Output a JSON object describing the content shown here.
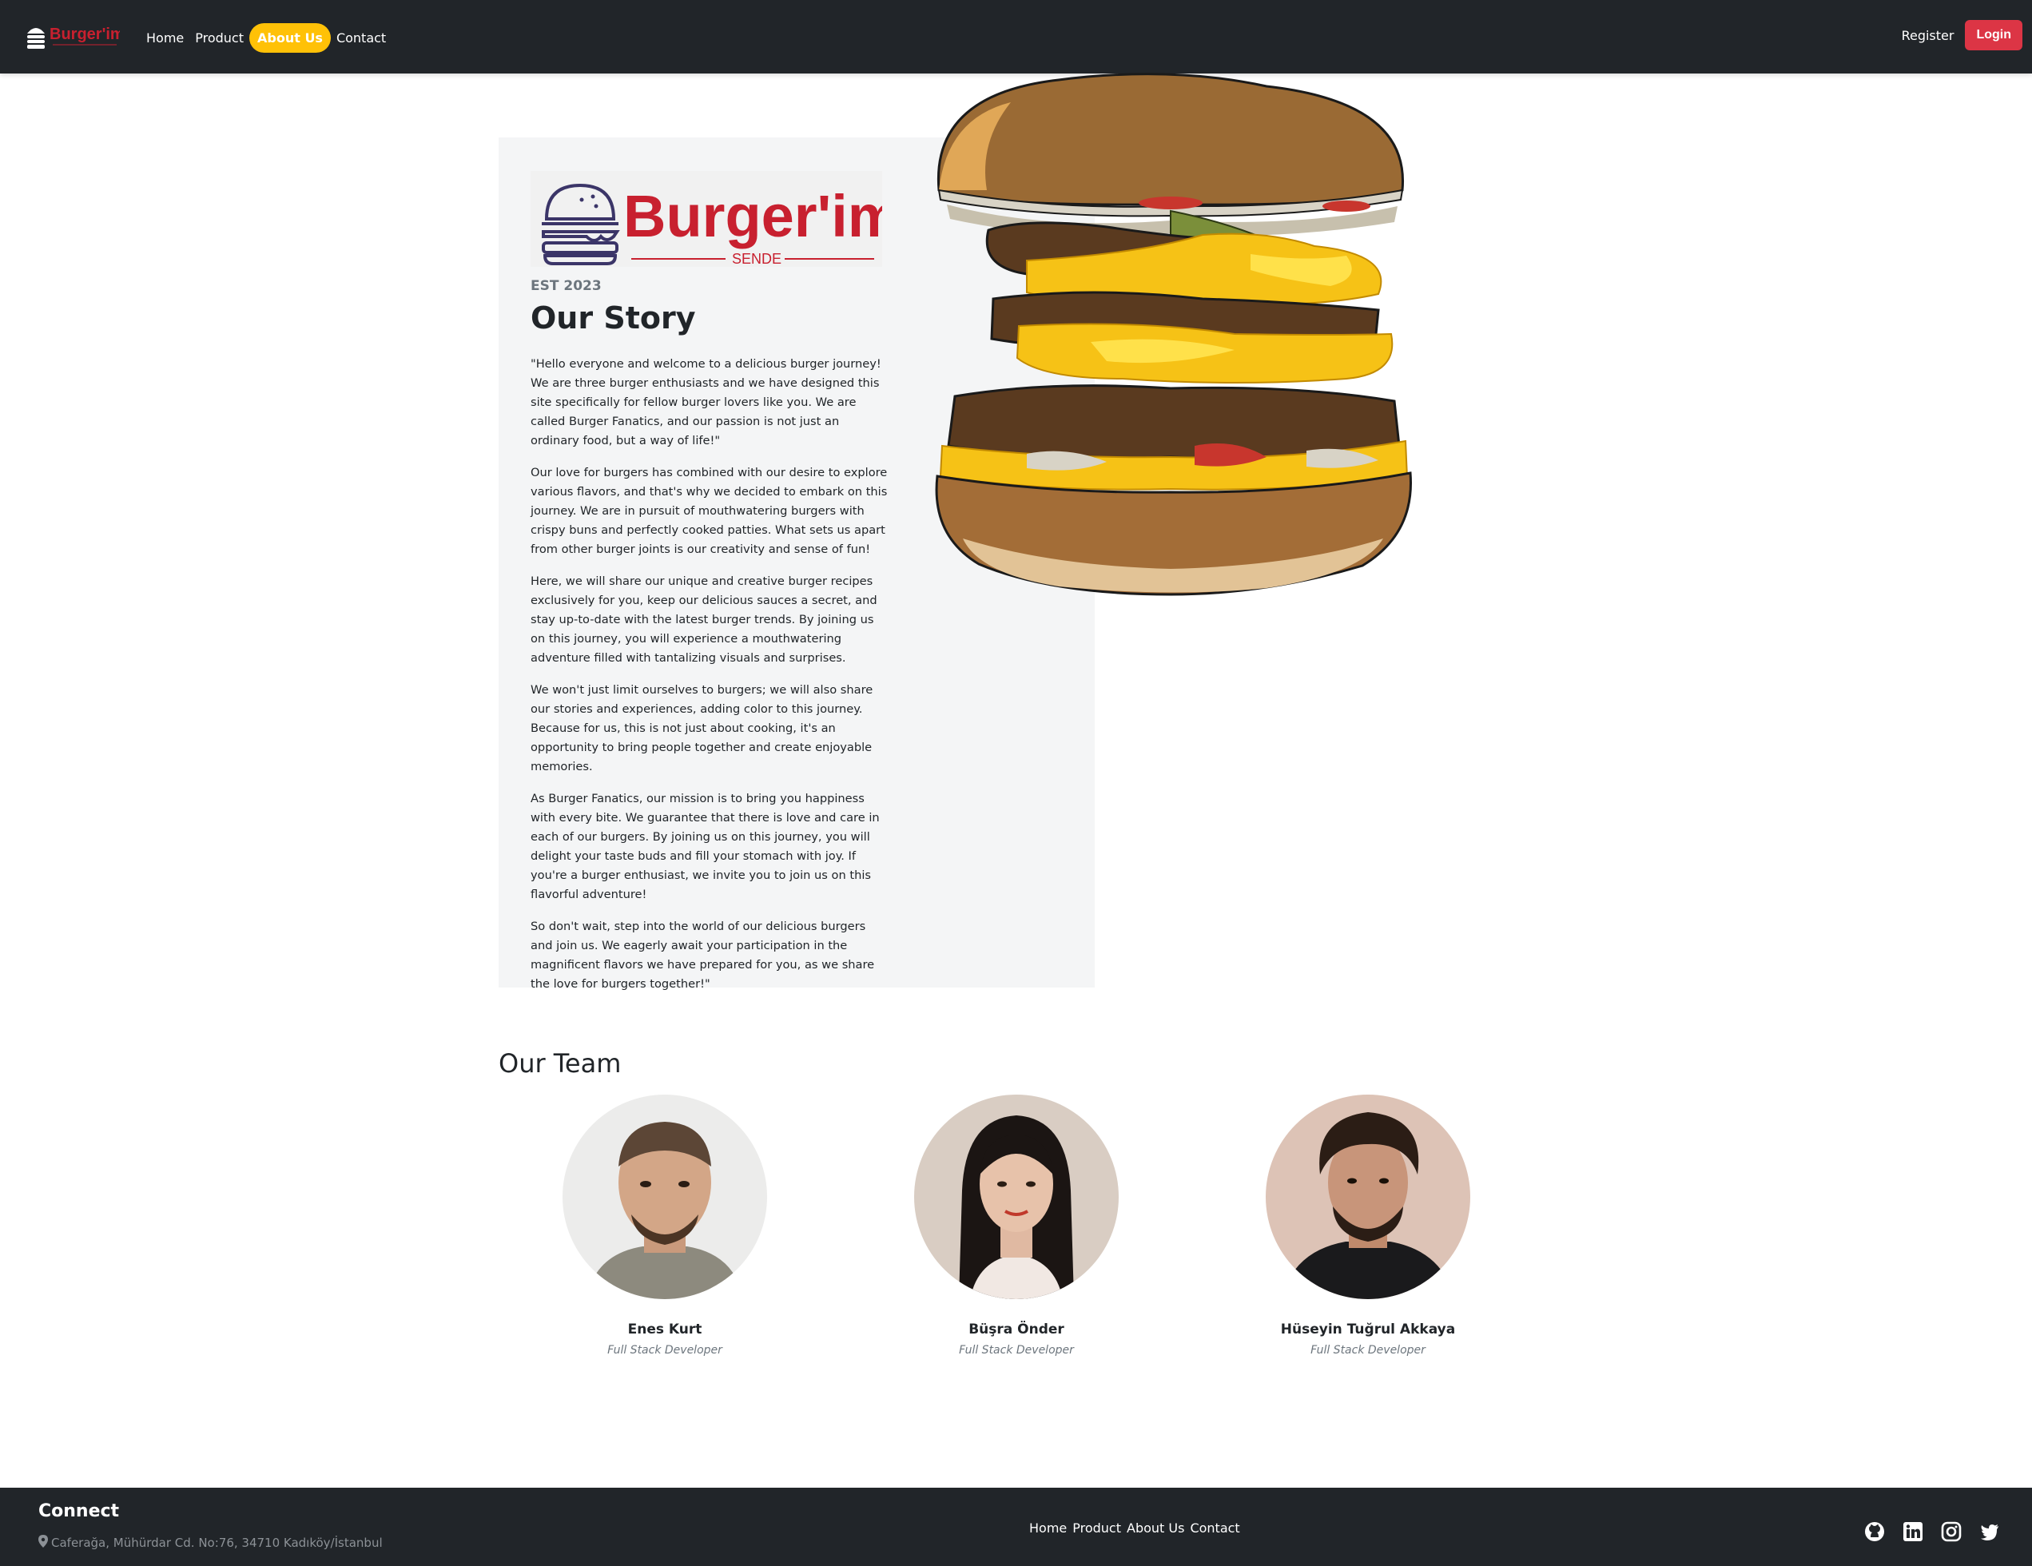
{
  "navbar": {
    "brand": "Burger'im",
    "links": [
      "Home",
      "Product",
      "About Us",
      "Contact"
    ],
    "active_link": "About Us",
    "register": "Register",
    "login": "Login"
  },
  "story": {
    "logo_text": "Burger'im",
    "logo_subtext": "SENDE",
    "est": "EST 2023",
    "title": "Our Story",
    "paragraphs": [
      "\"Hello everyone and welcome to a delicious burger journey! We are three burger enthusiasts and we have designed this site specifically for fellow burger lovers like you. We are called Burger Fanatics, and our passion is not just an ordinary food, but a way of life!\"",
      "Our love for burgers has combined with our desire to explore various flavors, and that's why we decided to embark on this journey. We are in pursuit of mouthwatering burgers with crispy buns and perfectly cooked patties. What sets us apart from other burger joints is our creativity and sense of fun!",
      "Here, we will share our unique and creative burger recipes exclusively for you, keep our delicious sauces a secret, and stay up-to-date with the latest burger trends. By joining us on this journey, you will experience a mouthwatering adventure filled with tantalizing visuals and surprises.",
      "We won't just limit ourselves to burgers; we will also share our stories and experiences, adding color to this journey. Because for us, this is not just about cooking, it's an opportunity to bring people together and create enjoyable memories.",
      "As Burger Fanatics, our mission is to bring you happiness with every bite. We guarantee that there is love and care in each of our burgers. By joining us on this journey, you will delight your taste buds and fill your stomach with joy. If you're a burger enthusiast, we invite you to join us on this flavorful adventure!",
      "So don't wait, step into the world of our delicious burgers and join us. We eagerly await your participation in the magnificent flavors we have prepared for you, as we share the love for burgers together!\""
    ]
  },
  "team": {
    "title": "Our Team",
    "members": [
      {
        "name": "Enes Kurt",
        "role": "Full Stack Developer"
      },
      {
        "name": "Büşra Önder",
        "role": "Full Stack Developer"
      },
      {
        "name": "Hüseyin Tuğrul Akkaya",
        "role": "Full Stack Developer"
      }
    ]
  },
  "footer": {
    "heading": "Connect",
    "address": "Caferağa, Mühürdar Cd. No:76, 34710 Kadıköy/İstanbul",
    "links": [
      "Home",
      "Product",
      "About Us",
      "Contact"
    ],
    "social_icons": [
      "github-icon",
      "linkedin-icon",
      "instagram-icon",
      "twitter-icon"
    ]
  },
  "colors": {
    "navbar_bg": "#212529",
    "active_pill": "#ffc107",
    "login_button": "#dc3545",
    "brand_red": "#c8202f",
    "story_card_bg": "#f4f5f6"
  }
}
